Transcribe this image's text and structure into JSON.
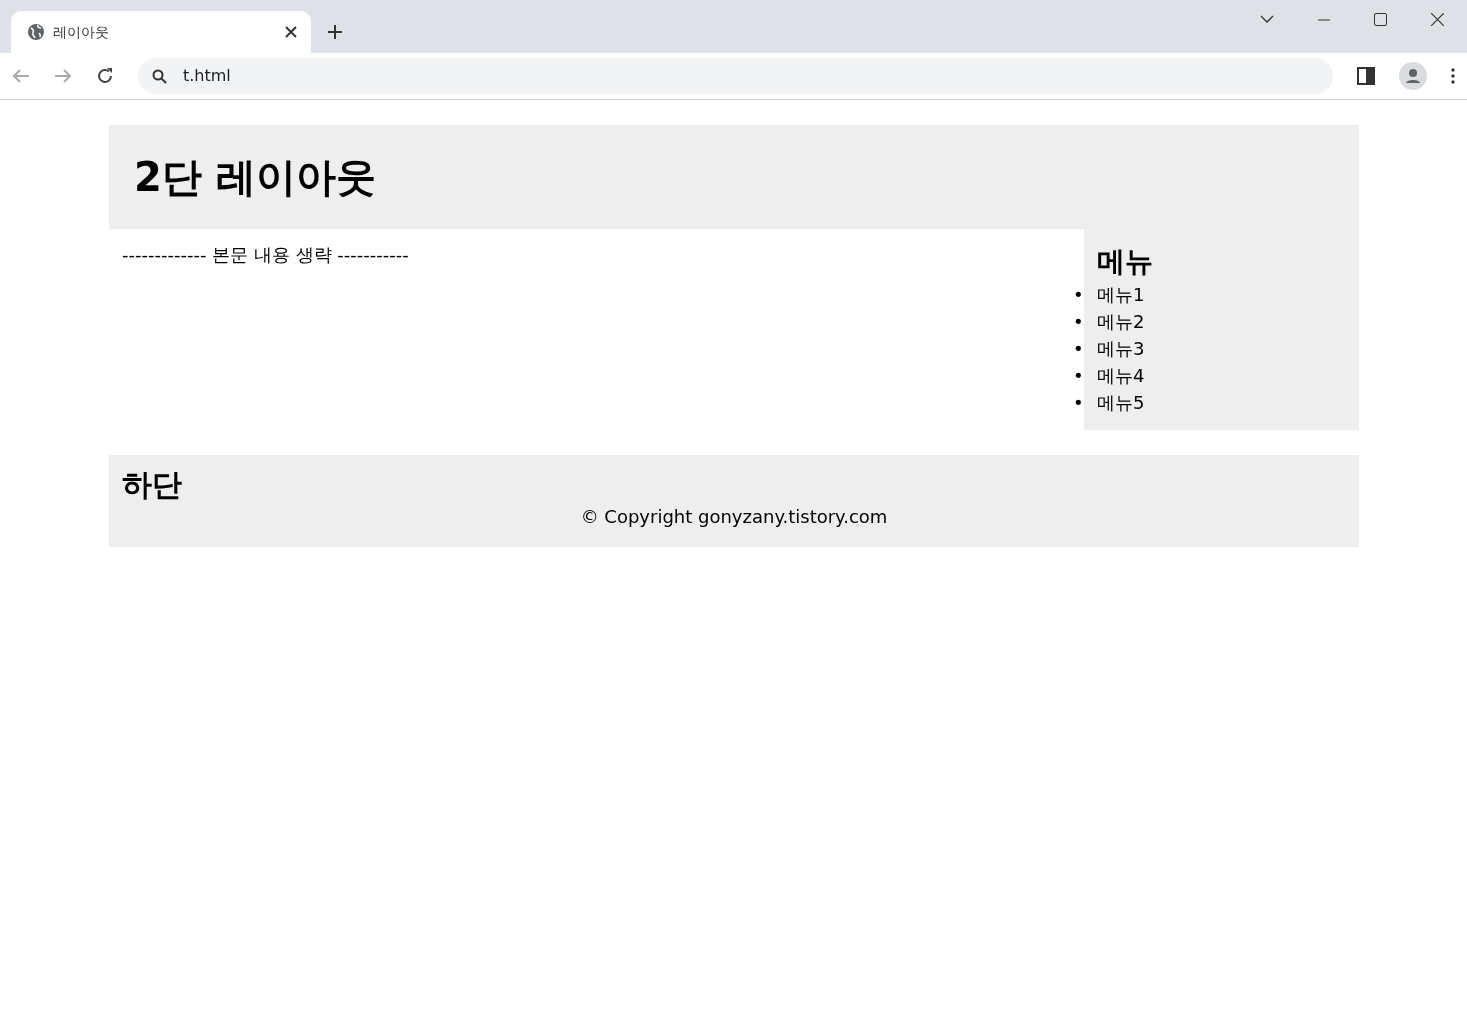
{
  "browser": {
    "tab": {
      "title": "레이아웃",
      "selected": true
    },
    "address": "t.html"
  },
  "page": {
    "header": {
      "title": "2단 레이아웃"
    },
    "content": {
      "text": "------------- 본문 내용 생략 -----------"
    },
    "sidebar": {
      "title": "메뉴",
      "items": [
        {
          "marker": "•",
          "label": "메뉴1"
        },
        {
          "marker": "•",
          "label": "메뉴2"
        },
        {
          "marker": "•",
          "label": "메뉴3"
        },
        {
          "marker": "•",
          "label": "메뉴4"
        },
        {
          "marker": "•",
          "label": "메뉴5"
        }
      ]
    },
    "footer": {
      "title": "하단",
      "copyright": "© Copyright gonyzany.tistory.com"
    }
  }
}
